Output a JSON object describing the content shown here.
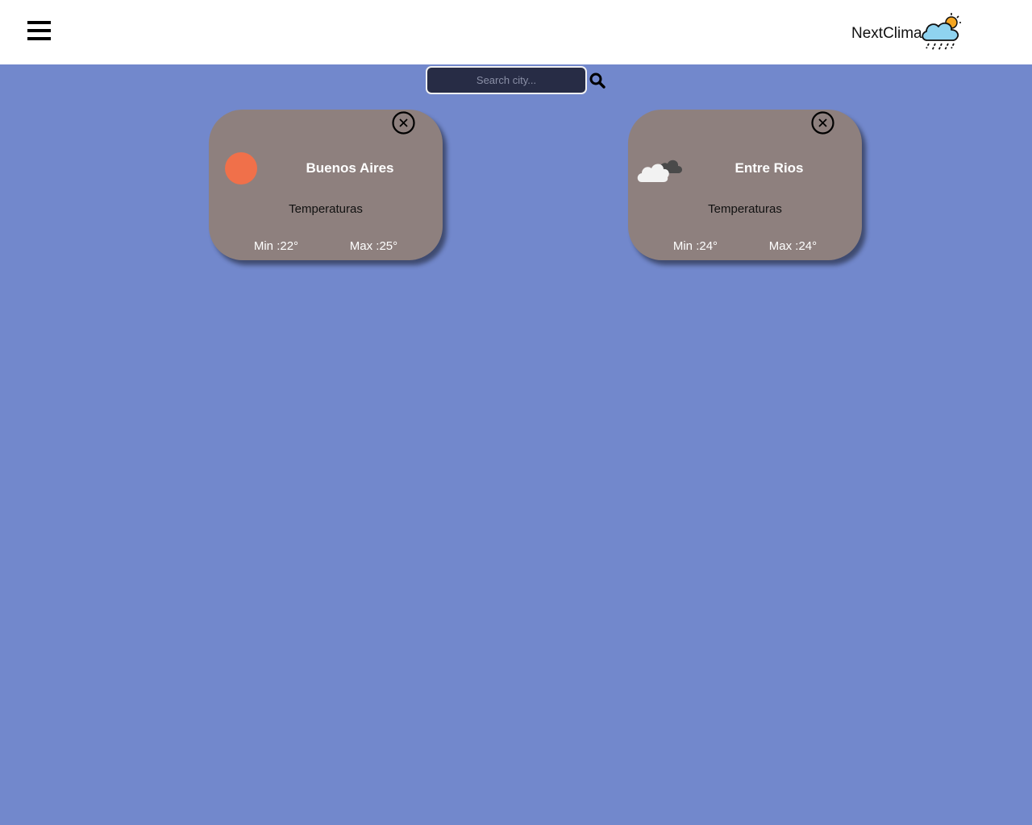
{
  "header": {
    "brand_name": "NextClima"
  },
  "search": {
    "placeholder": "Search city..."
  },
  "cards": [
    {
      "city": "Buenos Aires",
      "icon": "sun-icon",
      "temps_label": "Temperaturas",
      "min": "Min :22°",
      "max": "Max :25°"
    },
    {
      "city": "Entre Rios",
      "icon": "cloud-icon",
      "temps_label": "Temperaturas",
      "min": "Min :24°",
      "max": "Max :24°"
    }
  ],
  "colors": {
    "background": "#7288cc",
    "card": "#8e807e",
    "search_bg": "#272c45",
    "sun": "#f0704a"
  }
}
